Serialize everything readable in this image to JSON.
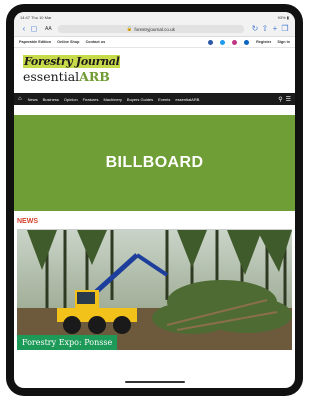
{
  "status": {
    "time": "14:47",
    "date": "Thu 10 Mar",
    "battery": "93% ▮"
  },
  "browser": {
    "url": "forestryjournal.co.uk",
    "aa": "AA"
  },
  "site_topbar": {
    "links": [
      "Paperable Edition",
      "Online Shop",
      "Contact us"
    ],
    "account": [
      "Register",
      "Sign in"
    ]
  },
  "logo": {
    "line1": "Forestry Journal",
    "line2_prefix": "essential",
    "line2_suffix": "ARB"
  },
  "nav": {
    "items": [
      "News",
      "Business",
      "Opinion",
      "Features",
      "Machinery",
      "Buyers Guides",
      "Events",
      "essentialARB"
    ]
  },
  "billboard": {
    "label": "BILLBOARD"
  },
  "news": {
    "section_label": "NEWS",
    "caption": "Forestry Expo: Ponsse"
  },
  "colors": {
    "billboard_bg": "#6f9e36",
    "nav_bg": "#1b1b1b",
    "caption_bg": "#1d9a58",
    "news_label": "#d3402a"
  }
}
